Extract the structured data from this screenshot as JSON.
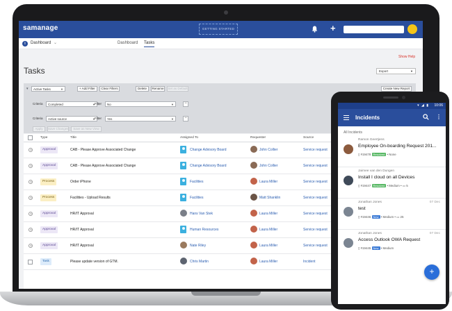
{
  "brand": {
    "logo": "samanage",
    "accent": "#2a4e9c"
  },
  "topbar": {
    "getting_started": "GETTING STARTED",
    "bell_icon": "bell-icon",
    "add_icon": "+"
  },
  "subnav": {
    "dashboard": "Dashboard",
    "tabs": [
      {
        "label": "Dashboard",
        "active": false
      },
      {
        "label": "Tasks",
        "active": true
      }
    ]
  },
  "page": {
    "show_help": "Show Help",
    "title": "Tasks",
    "export": "Export"
  },
  "filters": {
    "view": "Active Tasks",
    "add_filter": "+ Add Filter",
    "clear_filters": "Clear Filters",
    "delete": "Delete",
    "rename": "Rename",
    "set_default": "Set as Default",
    "create_report": "Create New Report",
    "criteria_label": "Criteria",
    "filter_label": "Filter",
    "criteria_1": "Completed",
    "filter_1": "No",
    "criteria_2": "Active source",
    "filter_2": "Yes",
    "minus": "−",
    "action_1": "Apply",
    "action_2": "Save Changes",
    "action_3": "Save as New View"
  },
  "table": {
    "headers": {
      "type": "Type",
      "title": "Title",
      "assigned": "Assigned To",
      "requester": "Requester",
      "source": "Source"
    },
    "rows": [
      {
        "type": "Approval",
        "title": "CAB - Please Approve Associated Change",
        "assigned": "Change Advisory Board",
        "requester": "John Collier",
        "source": "Service request"
      },
      {
        "type": "Approval",
        "title": "CAB - Please Approve Associated Change",
        "assigned": "Change Advisory Board",
        "requester": "John Collier",
        "source": "Service request"
      },
      {
        "type": "Process",
        "title": "Order iPhone",
        "assigned": "Facilities",
        "requester": "Laura Miller",
        "source": "Service request"
      },
      {
        "type": "Process",
        "title": "Facilities - Upload Results",
        "assigned": "Facilities",
        "requester": "Matt Shanklin",
        "source": "Service request"
      },
      {
        "type": "Approval",
        "title": "HR/IT Approval",
        "assigned": "Hans Van Stek",
        "requester": "Laura Miller",
        "source": "Service request"
      },
      {
        "type": "Approval",
        "title": "HR/IT Approval",
        "assigned": "Human Resources",
        "requester": "Laura Miller",
        "source": "Service request"
      },
      {
        "type": "Approval",
        "title": "HR/IT Approval",
        "assigned": "Nate Riley",
        "requester": "Laura Miller",
        "source": "Service request"
      },
      {
        "type": "Task",
        "title": "Please update version of GTM.",
        "assigned": "Chris Martin",
        "requester": "Laura Miller",
        "source": "Incident"
      }
    ]
  },
  "phone": {
    "status_icons": "▾ ◢ ▮",
    "time": "10:06",
    "title": "Incidents",
    "search_icon": "search-icon",
    "more": "⋮",
    "section": "All Incidents",
    "fab": "+",
    "cards": [
      {
        "who": "Ramon Geertjens",
        "date": "",
        "subject": "Employee On-boarding Request 201...",
        "number": "#19478",
        "status": "Resolved",
        "priority": "None",
        "tail": ""
      },
      {
        "who": "Jaimee van den Dungen",
        "date": "",
        "subject": "Install I cloud on all Devices",
        "number": "#19447",
        "status": "Resolved",
        "priority": "Medium",
        "tail": "5"
      },
      {
        "who": "Jonathan Jones",
        "date": "07 Dec",
        "subject": "test",
        "number": "#19446",
        "status": "New",
        "priority": "Medium",
        "tail": "25"
      },
      {
        "who": "Jonathan Jones",
        "date": "07 Dec",
        "subject": "Access Outlook OWA Request",
        "number": "#19445",
        "status": "New",
        "priority": "Medium",
        "tail": ""
      }
    ]
  }
}
